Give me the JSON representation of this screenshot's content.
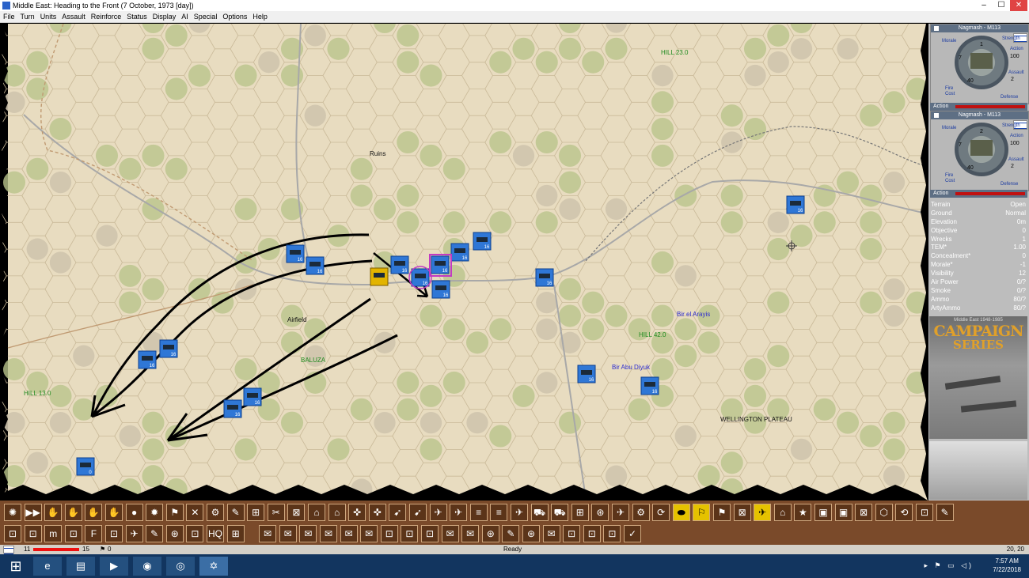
{
  "window": {
    "title": "Middle East: Heading to the Front (7 October, 1973 [day])",
    "minimize": "–",
    "maximize": "☐",
    "close": "✕"
  },
  "menu": [
    "File",
    "Turn",
    "Units",
    "Assault",
    "Reinforce",
    "Status",
    "Display",
    "AI",
    "Special",
    "Options",
    "Help"
  ],
  "map": {
    "labels": [
      {
        "text": "HILL 23.0",
        "color": "#1d8a1d"
      },
      {
        "text": "Ruins",
        "color": "#111"
      },
      {
        "text": "Airfield",
        "color": "#111"
      },
      {
        "text": "BALUZA",
        "color": "#1d8a1d"
      },
      {
        "text": "Bir el Arayis",
        "color": "#2b2bd0"
      },
      {
        "text": "HILL 42.0",
        "color": "#1d8a1d"
      },
      {
        "text": "Bir Abu Diyuk",
        "color": "#2b2bd0"
      },
      {
        "text": "HILL 13.0",
        "color": "#1d8a1d"
      },
      {
        "text": "WELLINGTON PLATEAU",
        "color": "#111"
      }
    ],
    "units": [
      {
        "num": "16"
      },
      {
        "num": "16"
      },
      {
        "num": "16"
      },
      {
        "num": "16"
      },
      {
        "num": "16"
      },
      {
        "num": "16"
      },
      {
        "num": "16"
      },
      {
        "num": "16"
      },
      {
        "num": "16"
      },
      {
        "num": "16"
      },
      {
        "num": "16"
      },
      {
        "num": "16"
      },
      {
        "num": "16"
      },
      {
        "num": "16"
      },
      {
        "num": "16"
      },
      {
        "num": "16"
      },
      {
        "num": "0"
      }
    ],
    "colors": {
      "hex_fill": "#e8dcc0",
      "hex_line": "#c9b998",
      "unit": "#2f77d6",
      "selected": "#e2b400",
      "arrow": "#000000"
    }
  },
  "unit_cards": [
    {
      "title": "Nagmash - M113",
      "strength": "1",
      "action": "100",
      "morale": "7",
      "fire": "40",
      "assault": "2",
      "labels": {
        "morale": "Morale",
        "strength": "Strength",
        "action": "Action",
        "assault": "Assault",
        "fire": "Fire",
        "cost": "Cost",
        "defense": "Defense"
      },
      "action_label": "Action"
    },
    {
      "title": "Nagmash - M113",
      "strength": "2",
      "action": "100",
      "morale": "7",
      "fire": "40",
      "assault": "2",
      "labels": {
        "morale": "Morale",
        "strength": "Strength",
        "action": "Action",
        "assault": "Assault",
        "fire": "Fire",
        "cost": "Cost",
        "defense": "Defense"
      },
      "action_label": "Action"
    }
  ],
  "terrain": [
    {
      "k": "Terrain",
      "v": "Open"
    },
    {
      "k": "Ground",
      "v": "Normal"
    },
    {
      "k": "Elevation",
      "v": "0m"
    },
    {
      "k": "Objective",
      "v": "0"
    },
    {
      "k": "Wrecks",
      "v": "1"
    },
    {
      "k": "TEM*",
      "v": "1.00"
    },
    {
      "k": "Concealment*",
      "v": "0"
    },
    {
      "k": "Morale*",
      "v": "-1"
    },
    {
      "k": "Visibility",
      "v": "12"
    },
    {
      "k": "Air Power",
      "v": "0/?"
    },
    {
      "k": "Smoke",
      "v": "0/?"
    },
    {
      "k": "Ammo",
      "v": "80/?"
    },
    {
      "k": "ArtyAmmo",
      "v": "80/?"
    }
  ],
  "logo": {
    "sub": "Middle East 1948-1985",
    "line1": "CAMPAIGN",
    "line2": "SERIES"
  },
  "toolbar_row1": [
    "✺",
    "▶▶",
    "✋",
    "✋",
    "✋",
    "✋",
    "●",
    "✹",
    "⚑",
    "✕",
    "⚙",
    "✎",
    "⊞",
    "✂",
    "⊠",
    "⌂",
    "⌂",
    "✜",
    "✜",
    "➹",
    "➹",
    "✈",
    "✈",
    "≡",
    "≡",
    "✈",
    "⛟",
    "⛟",
    "⊞",
    "⊛",
    "✈",
    "⚙",
    "⟳",
    "⬬",
    "⚐",
    "⚑",
    "⊠",
    "✈",
    "⌂",
    "★",
    "▣",
    "▣",
    "⊠",
    "⬡",
    "⟲",
    "⊡",
    "✎"
  ],
  "toolbar_row2": [
    "⊡",
    "⊡",
    "m",
    "⊡",
    "F",
    "⊡",
    "✈",
    "✎",
    "⊛",
    "⊡",
    "HQ",
    "⊞",
    "✉",
    "✉",
    "✉",
    "✉",
    "✉",
    "✉",
    "⊡",
    "⊡",
    "⊡",
    "✉",
    "✉",
    "⊛",
    "✎",
    "⊛",
    "✉",
    "⊡",
    "⊡",
    "⊡",
    "✓"
  ],
  "status": {
    "flag_label": "IL",
    "value1": "11",
    "value2": "15",
    "value3": "0",
    "ready": "Ready",
    "coords": "20, 20"
  },
  "taskbar": {
    "time": "7:57 AM",
    "date": "7/22/2018",
    "start": "⊞",
    "apps": [
      "e",
      "▤",
      "▶",
      "◉",
      "◎",
      "✡"
    ],
    "tray": "▸ ⚑ ▭ ◁)"
  }
}
